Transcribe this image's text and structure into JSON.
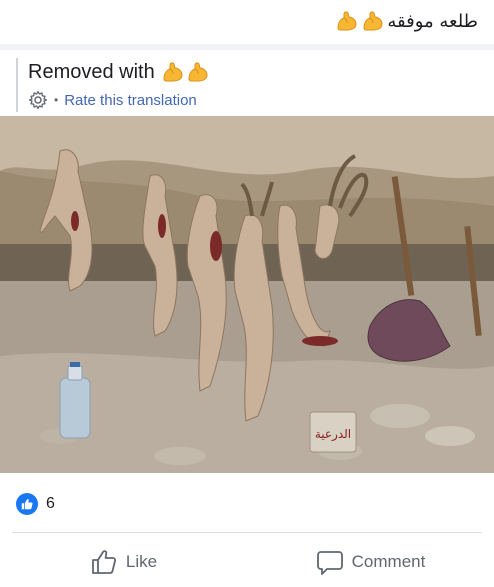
{
  "post": {
    "original_text": "طلعه موفقه",
    "original_emoji": [
      "flexed-biceps-emoji",
      "flexed-biceps-emoji"
    ]
  },
  "translation": {
    "removed_label": "Removed with",
    "removed_emoji": [
      "flexed-biceps-emoji",
      "flexed-biceps-emoji"
    ],
    "separator": "•",
    "rate_label": "Rate this translation"
  },
  "image": {
    "sign_text": "الدرعية"
  },
  "reactions": {
    "icon": "like-icon",
    "count": "6"
  },
  "actions": {
    "like_label": "Like",
    "comment_label": "Comment"
  },
  "colors": {
    "brand_blue": "#1877f2",
    "link_blue": "#4267b2",
    "muted": "#606770"
  }
}
